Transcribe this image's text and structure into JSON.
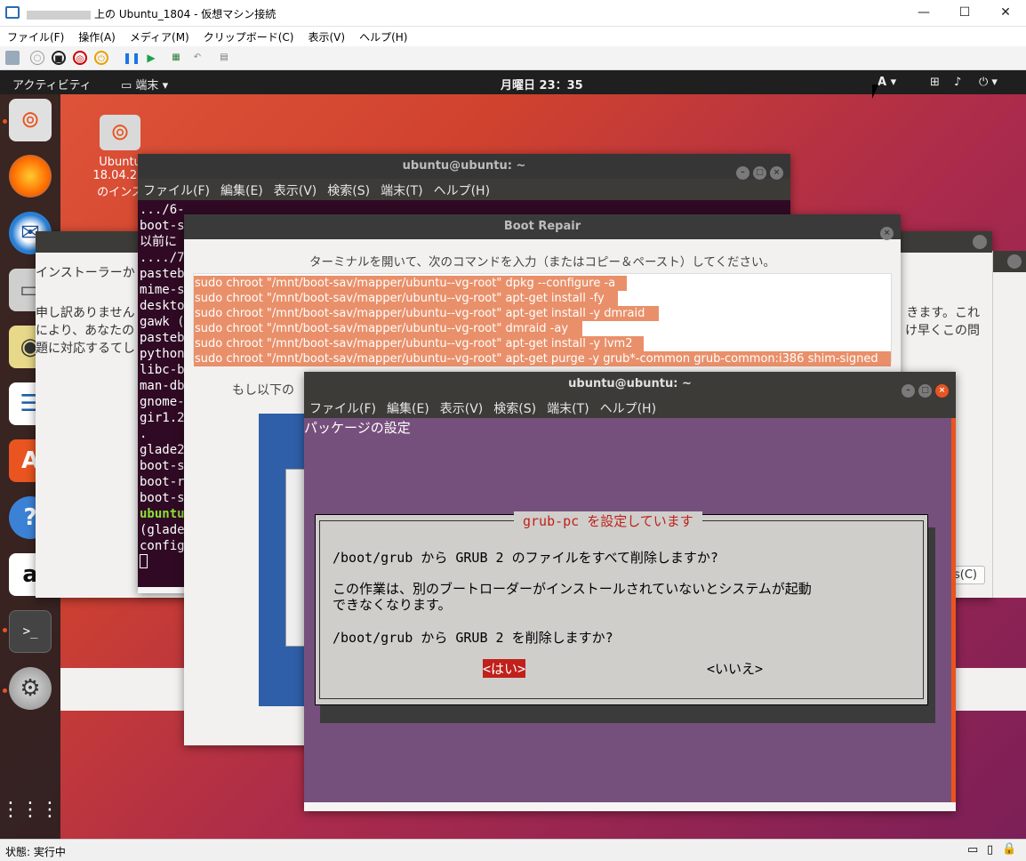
{
  "host": {
    "title": "上の Ubuntu_1804 - 仮想マシン接続",
    "menu": [
      "ファイル(F)",
      "操作(A)",
      "メディア(M)",
      "クリップボード(C)",
      "表示(V)",
      "ヘルプ(H)"
    ],
    "status": "状態: 実行中"
  },
  "ubuntu": {
    "activities": "アクティビティ",
    "app_menu": "端末",
    "clock": "月曜日 23：35",
    "input_method": "A"
  },
  "desktop_icon": {
    "line1": "Ubuntu",
    "line2": "18.04.2 L",
    "line3": "のインス"
  },
  "installer": {
    "label": "インストーラーか",
    "text1": "申し訳ありません",
    "text2": "により、あなたの",
    "text3": "題に対応するてし",
    "right1": "きます。これ",
    "right2": "け早くこの問",
    "button": "s(C)"
  },
  "term1": {
    "title": "ubuntu@ubuntu: ~",
    "menu": [
      "ファイル(F)",
      "編集(E)",
      "表示(V)",
      "検索(S)",
      "端末(T)",
      "ヘルプ(H)"
    ],
    "lines": [
      ".../6-",
      "boot-s",
      "以前に",
      "..../7-",
      "pasteb",
      "mime-s",
      "deskto",
      "gawk (",
      "pasteb",
      "python",
      "libc-b",
      "man-db",
      "gnome-",
      "gir1.2",
      ".",
      "glade2",
      "boot-s",
      "boot-r",
      "boot-s",
      "ubuntu",
      "",
      "(glade",
      "config"
    ]
  },
  "boot_repair": {
    "title": "Boot Repair",
    "instruction": "ターミナルを開いて、次のコマンドを入力（またはコピー＆ペースト）してください。",
    "commands": [
      "sudo chroot \"/mnt/boot-sav/mapper/ubuntu--vg-root\" dpkg --configure -a",
      "sudo chroot \"/mnt/boot-sav/mapper/ubuntu--vg-root\" apt-get install -fy",
      "sudo chroot \"/mnt/boot-sav/mapper/ubuntu--vg-root\" apt-get install -y dmraid",
      "sudo chroot \"/mnt/boot-sav/mapper/ubuntu--vg-root\" dmraid -ay",
      "sudo chroot \"/mnt/boot-sav/mapper/ubuntu--vg-root\" apt-get install -y lvm2",
      "sudo chroot \"/mnt/boot-sav/mapper/ubuntu--vg-root\" apt-get purge -y grub*-common grub-common:i386 shim-signed"
    ],
    "partial": "もし以下の"
  },
  "term2": {
    "title": "ubuntu@ubuntu: ~",
    "menu": [
      "ファイル(F)",
      "編集(E)",
      "表示(V)",
      "検索(S)",
      "端末(T)",
      "ヘルプ(H)"
    ],
    "header": "パッケージの設定",
    "dialog": {
      "title": "grub-pc を設定しています",
      "q1": "/boot/grub から GRUB 2 のファイルをすべて削除しますか?",
      "p1": "この作業は、別のブートローダーがインストールされていないとシステムが起動",
      "p2": "できなくなります。",
      "q2": "/boot/grub から GRUB 2 を削除しますか?",
      "yes": "<はい>",
      "no": "<いいえ>"
    }
  },
  "colors": {
    "ubuntu_orange": "#e95420",
    "terminal_bg": "#300a24",
    "whiptail_bg": "#76507c",
    "selection": "#e9906a"
  }
}
